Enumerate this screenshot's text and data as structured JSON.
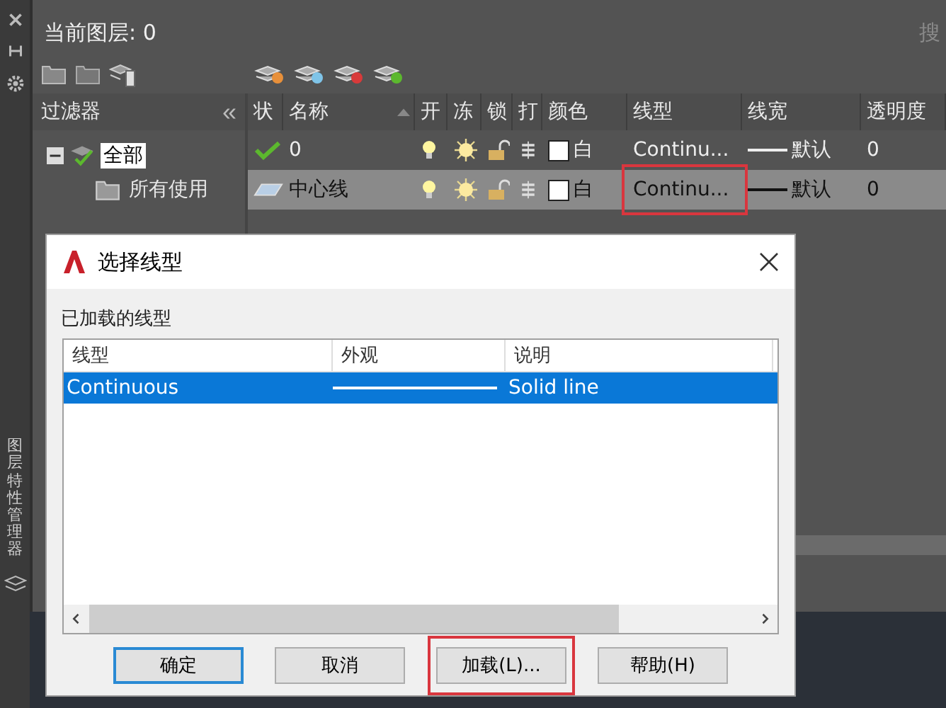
{
  "sidebar": {
    "title": "图层特性管理器"
  },
  "search": {
    "placeholder": "搜"
  },
  "current_layer": "当前图层: 0",
  "filters": {
    "title": "过滤器",
    "collapse": "«",
    "tree": [
      {
        "label": "全部",
        "selected": true,
        "expanded": true,
        "children": [
          {
            "label": "所有使用",
            "selected": false
          }
        ]
      }
    ]
  },
  "layers": {
    "columns": [
      "状",
      "名称",
      "开",
      "冻",
      "锁",
      "打",
      "颜色",
      "线型",
      "线宽",
      "透明度"
    ],
    "rows": [
      {
        "current": true,
        "name": "0",
        "on": true,
        "frozen": false,
        "locked": false,
        "color_name": "白",
        "linetype": "Continu...",
        "lineweight": "默认",
        "transparency": "0",
        "selected": false,
        "highlighted": false
      },
      {
        "current": false,
        "name": "中心线",
        "on": true,
        "frozen": false,
        "locked": false,
        "color_name": "白",
        "linetype": "Continu...",
        "lineweight": "默认",
        "transparency": "0",
        "selected": true,
        "highlighted": true
      }
    ]
  },
  "dialog": {
    "title": "选择线型",
    "section_label": "已加载的线型",
    "columns": [
      "线型",
      "外观",
      "说明"
    ],
    "rows": [
      {
        "linetype": "Continuous",
        "description": "Solid line",
        "selected": true
      }
    ],
    "buttons": [
      {
        "label": "确定",
        "kind": "default",
        "highlighted": false
      },
      {
        "label": "取消",
        "kind": "normal",
        "highlighted": false
      },
      {
        "label": "加载(L)...",
        "kind": "normal",
        "highlighted": true
      },
      {
        "label": "帮助(H)",
        "kind": "normal",
        "highlighted": false
      }
    ]
  }
}
